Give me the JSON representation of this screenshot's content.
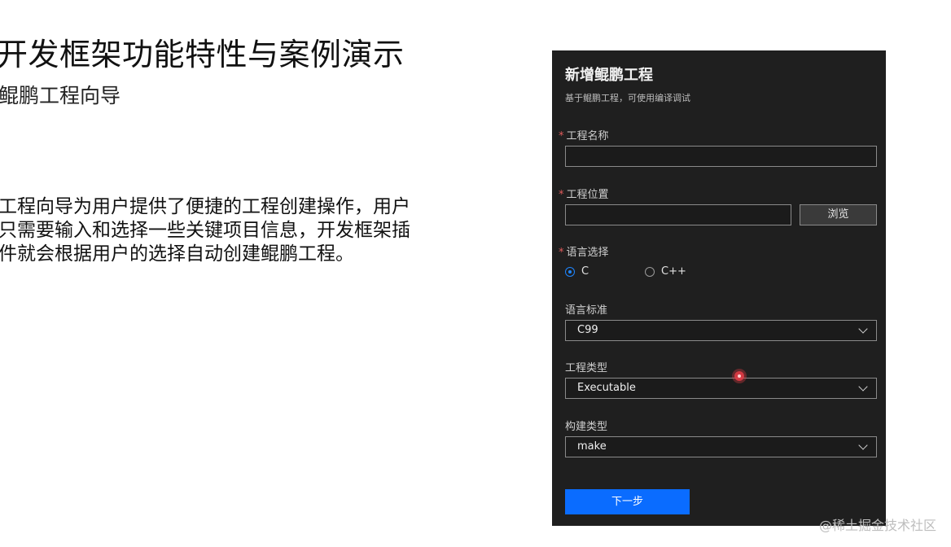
{
  "slide": {
    "title": "开发框架功能特性与案例演示",
    "subtitle": "鲲鹏工程向导",
    "body_lines": [
      "工程向导为用户提供了便捷的工程创建操作，用户",
      "只需要输入和选择一些关键项目信息，开发框架插",
      "件就会根据用户的选择自动创建鲲鹏工程。"
    ]
  },
  "dialog": {
    "title": "新增鲲鹏工程",
    "description": "基于鲲鹏工程，可使用编译调试",
    "required_marker": "*",
    "project_name_label": "工程名称",
    "project_name_value": "",
    "project_location_label": "工程位置",
    "project_location_value": "",
    "browse_button": "浏览",
    "language_label": "语言选择",
    "languages": [
      {
        "label": "C",
        "checked": true
      },
      {
        "label": "C++",
        "checked": false
      }
    ],
    "standard_label": "语言标准",
    "standard_value": "C99",
    "project_type_label": "工程类型",
    "project_type_value": "Executable",
    "build_type_label": "构建类型",
    "build_type_value": "make",
    "next_button": "下一步"
  },
  "watermark": "@稀土掘金技术社区",
  "colors": {
    "panel_bg": "#1f1f1f",
    "accent": "#0a6cff",
    "required": "#e05a5a"
  }
}
